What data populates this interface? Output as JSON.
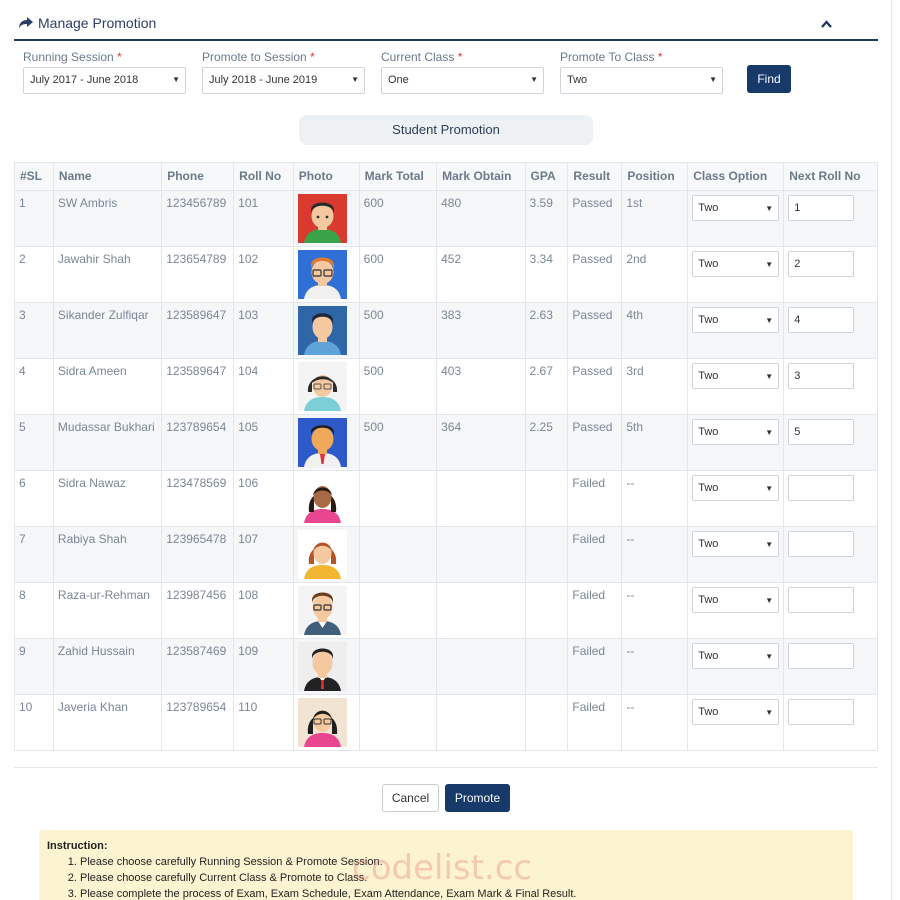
{
  "header": {
    "title": "Manage Promotion"
  },
  "filters": {
    "running_session": {
      "label": "Running Session",
      "required_mark": "*",
      "value": "July 2017 - June 2018"
    },
    "promote_session": {
      "label": "Promote to Session",
      "required_mark": "*",
      "value": "July 2018 - June 2019"
    },
    "current_class": {
      "label": "Current Class",
      "required_mark": "*",
      "value": "One"
    },
    "promote_class": {
      "label": "Promote To Class",
      "required_mark": "*",
      "value": "Two"
    },
    "find_label": "Find"
  },
  "section_title": "Student Promotion",
  "table": {
    "headers": [
      "#SL",
      "Name",
      "Phone",
      "Roll No",
      "Photo",
      "Mark Total",
      "Mark Obtain",
      "GPA",
      "Result",
      "Position",
      "Class Option",
      "Next Roll No"
    ],
    "rows": [
      {
        "sl": "1",
        "name": "SW Ambris",
        "phone": "123456789",
        "roll": "101",
        "avatar": "boy-avatar-red",
        "mark_total": "600",
        "mark_obtain": "480",
        "gpa": "3.59",
        "result": "Passed",
        "position": "1st",
        "class_option": "Two",
        "next_roll": "1"
      },
      {
        "sl": "2",
        "name": "Jawahir Shah",
        "phone": "123654789",
        "roll": "102",
        "avatar": "boy-glasses-avatar-blue",
        "mark_total": "600",
        "mark_obtain": "452",
        "gpa": "3.34",
        "result": "Passed",
        "position": "2nd",
        "class_option": "Two",
        "next_roll": "2"
      },
      {
        "sl": "3",
        "name": "Sikander Zulfiqar",
        "phone": "123589647",
        "roll": "103",
        "avatar": "man-avatar-blue",
        "mark_total": "500",
        "mark_obtain": "383",
        "gpa": "2.63",
        "result": "Passed",
        "position": "4th",
        "class_option": "Two",
        "next_roll": "4"
      },
      {
        "sl": "4",
        "name": "Sidra Ameen",
        "phone": "123589647",
        "roll": "104",
        "avatar": "woman-glasses-avatar",
        "mark_total": "500",
        "mark_obtain": "403",
        "gpa": "2.67",
        "result": "Passed",
        "position": "3rd",
        "class_option": "Two",
        "next_roll": "3"
      },
      {
        "sl": "5",
        "name": "Mudassar Bukhari",
        "phone": "123789654",
        "roll": "105",
        "avatar": "man-tie-avatar-blue",
        "mark_total": "500",
        "mark_obtain": "364",
        "gpa": "2.25",
        "result": "Passed",
        "position": "5th",
        "class_option": "Two",
        "next_roll": "5"
      },
      {
        "sl": "6",
        "name": "Sidra Nawaz",
        "phone": "123478569",
        "roll": "106",
        "avatar": "woman-avatar-pink",
        "mark_total": "",
        "mark_obtain": "",
        "gpa": "",
        "result": "Failed",
        "position": "--",
        "class_option": "Two",
        "next_roll": ""
      },
      {
        "sl": "7",
        "name": "Rabiya Shah",
        "phone": "123965478",
        "roll": "107",
        "avatar": "woman-avatar-yellow",
        "mark_total": "",
        "mark_obtain": "",
        "gpa": "",
        "result": "Failed",
        "position": "--",
        "class_option": "Two",
        "next_roll": ""
      },
      {
        "sl": "8",
        "name": "Raza-ur-Rehman",
        "phone": "123987456",
        "roll": "108",
        "avatar": "man-glasses-suit-avatar",
        "mark_total": "",
        "mark_obtain": "",
        "gpa": "",
        "result": "Failed",
        "position": "--",
        "class_option": "Two",
        "next_roll": ""
      },
      {
        "sl": "9",
        "name": "Zahid Hussain",
        "phone": "123587469",
        "roll": "109",
        "avatar": "man-suit-avatar",
        "mark_total": "",
        "mark_obtain": "",
        "gpa": "",
        "result": "Failed",
        "position": "--",
        "class_option": "Two",
        "next_roll": ""
      },
      {
        "sl": "10",
        "name": "Javeria Khan",
        "phone": "123789654",
        "roll": "110",
        "avatar": "woman-glasses-avatar-pattern",
        "mark_total": "",
        "mark_obtain": "",
        "gpa": "",
        "result": "Failed",
        "position": "--",
        "class_option": "Two",
        "next_roll": ""
      }
    ]
  },
  "actions": {
    "cancel_label": "Cancel",
    "promote_label": "Promote"
  },
  "instructions": {
    "title": "Instruction:",
    "items": [
      "Please choose carefully Running Session & Promote Session.",
      "Please choose carefully Current Class & Promote to Class.",
      "Please complete the process of Exam, Exam Schedule, Exam Attendance, Exam Mark & Final Result."
    ]
  },
  "watermark": "codelist.cc",
  "colors": {
    "primary": "#173a6a",
    "header_rule": "#1f3a5f",
    "required": "#e53935",
    "instruction_bg": "#fcf3d0"
  }
}
